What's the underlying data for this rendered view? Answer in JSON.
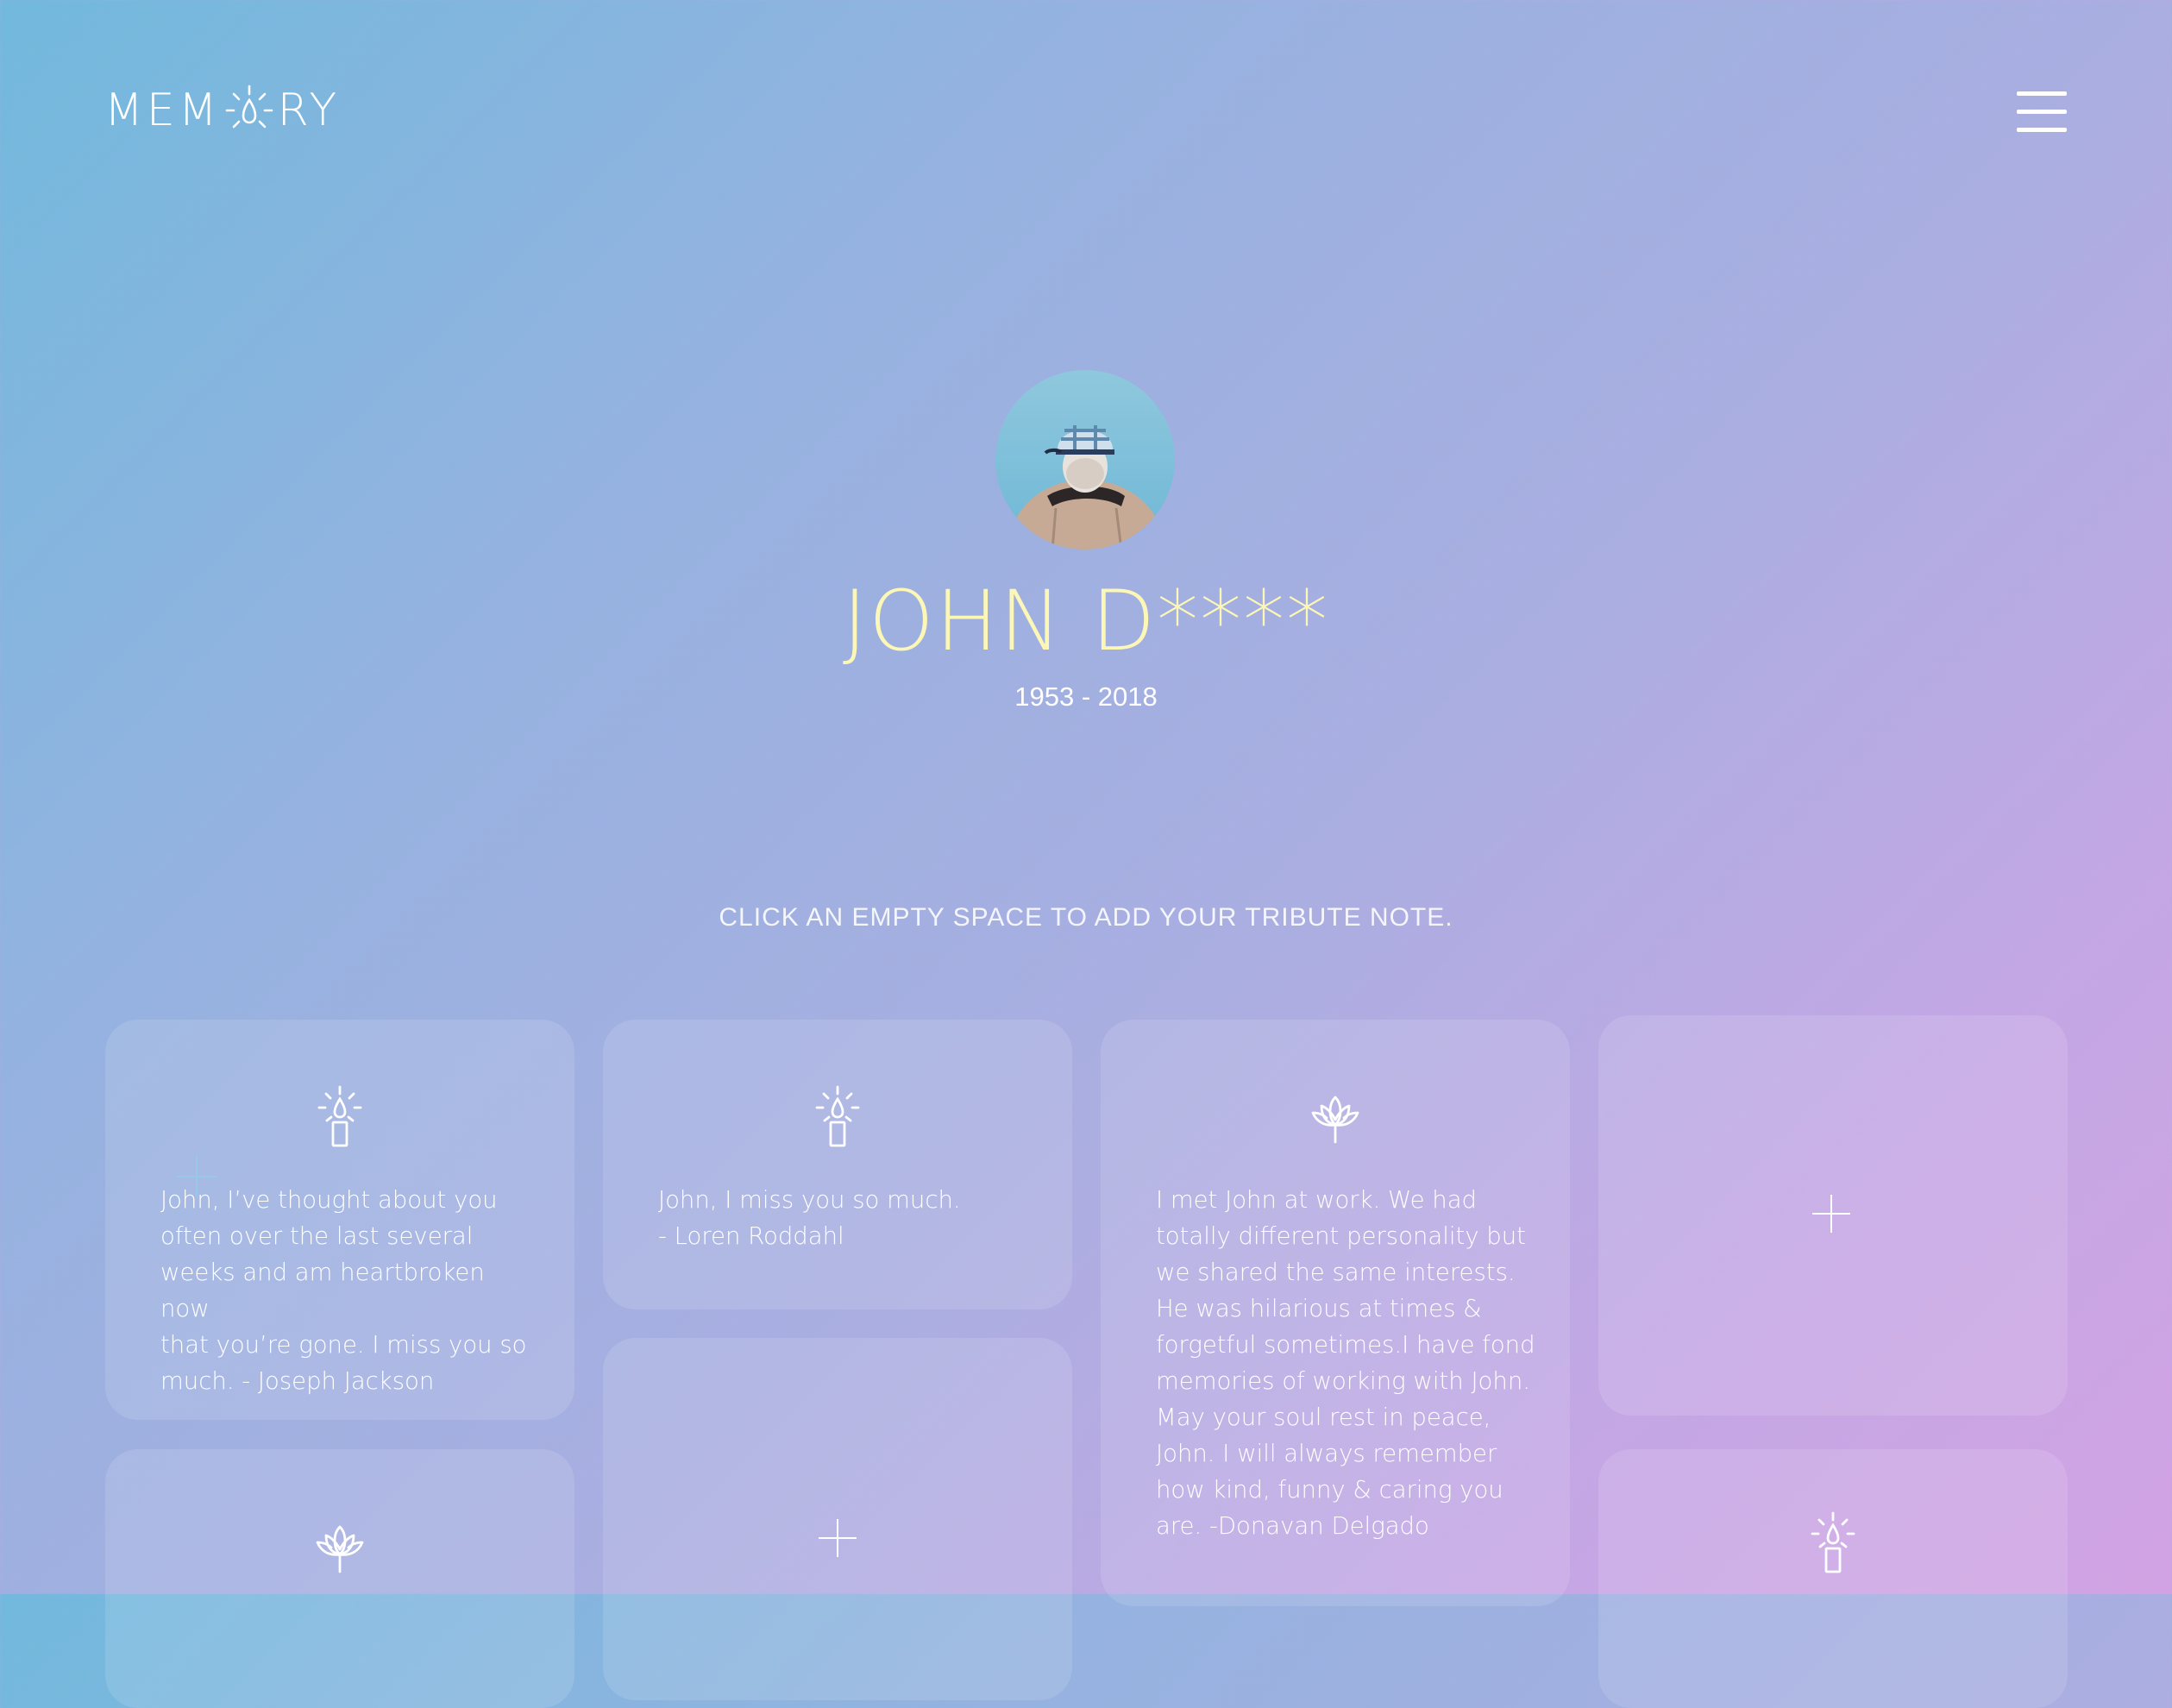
{
  "header": {
    "logo": {
      "before": "MEM",
      "after": "RY",
      "mark_icon": "candle-flame-icon"
    },
    "menu_icon": "hamburger-menu-icon"
  },
  "profile": {
    "name": "JOHN D****",
    "dates": "1953 - 2018",
    "avatar": "avatar"
  },
  "instruction": "CLICK AN EMPTY SPACE TO ADD YOUR TRIBUTE NOTE.",
  "tributes": [
    {
      "icon": "candle-icon",
      "text": "John, I’ve thought about you\noften over the last several\nweeks and am heartbroken now\nthat you’re gone. I miss you so\nmuch. - Joseph Jackson"
    },
    {
      "icon": "candle-icon",
      "text": "John, I miss you so much.\n- Loren Roddahl"
    },
    {
      "icon": "lotus-icon",
      "text": "I met John at work. We had\ntotally different personality but\nwe shared the same interests.\nHe was hilarious at times &\nforgetful sometimes.I have fond\nmemories of working with John.\nMay your soul rest in peace,\nJohn. I will always remember\nhow kind, funny & caring you\nare. -Donavan Delgado"
    },
    {
      "icon": "plus-icon",
      "text": ""
    },
    {
      "icon": "lotus-icon",
      "text": ""
    },
    {
      "icon": "plus-icon",
      "text": ""
    },
    {
      "icon": "candle-icon",
      "text": ""
    }
  ],
  "colors": {
    "gradient_start": "#72b9dd",
    "gradient_end": "#d2a3e4",
    "name": "#fcf7b6",
    "text": "#ffffff"
  }
}
